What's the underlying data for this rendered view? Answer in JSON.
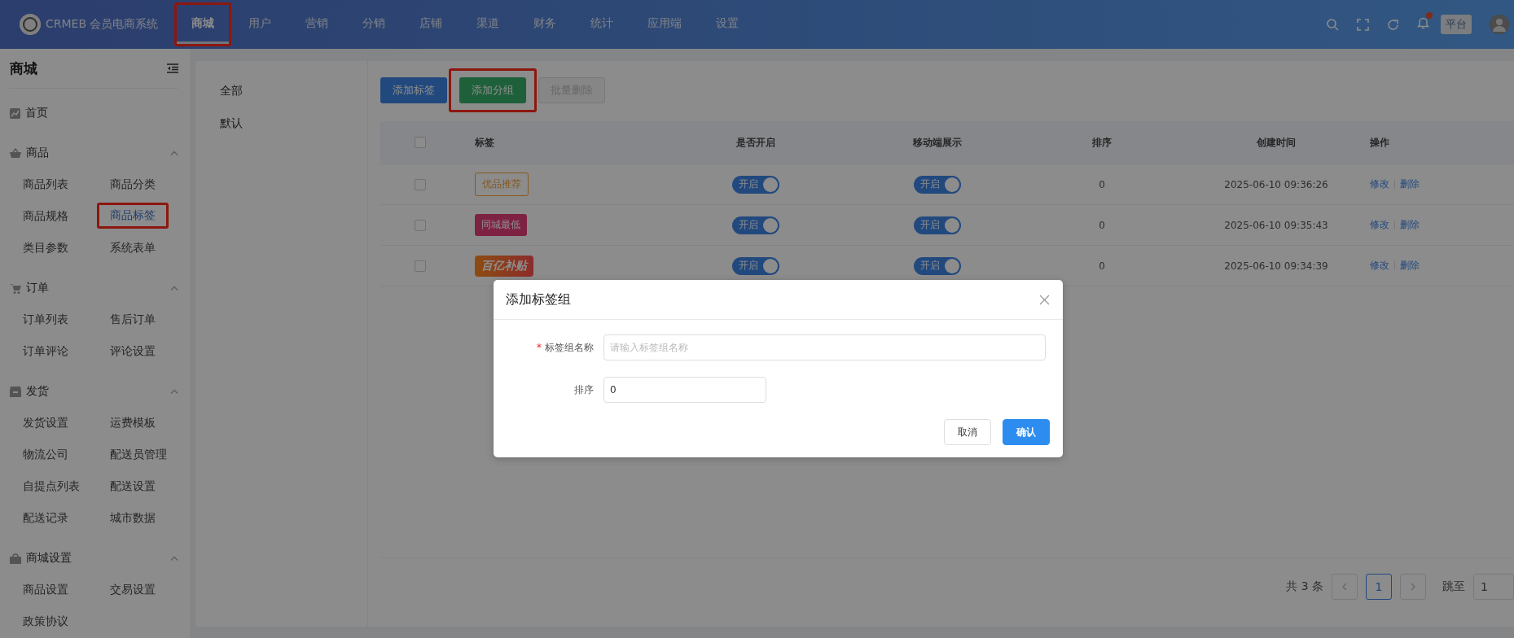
{
  "topbar": {
    "brand": "CRMEB 会员电商系统",
    "nav": [
      {
        "label": "商城",
        "selected": true,
        "highlighted": true
      },
      {
        "label": "用户",
        "selected": false,
        "highlighted": false
      },
      {
        "label": "营销",
        "selected": false,
        "highlighted": false
      },
      {
        "label": "分销",
        "selected": false,
        "highlighted": false
      },
      {
        "label": "店铺",
        "selected": false,
        "highlighted": false
      },
      {
        "label": "渠道",
        "selected": false,
        "highlighted": false
      },
      {
        "label": "财务",
        "selected": false,
        "highlighted": false
      },
      {
        "label": "统计",
        "selected": false,
        "highlighted": false
      },
      {
        "label": "应用端",
        "selected": false,
        "highlighted": false
      },
      {
        "label": "设置",
        "selected": false,
        "highlighted": false
      }
    ],
    "notification_dot": true,
    "role_badge": "平台"
  },
  "sidebar": {
    "title": "商城",
    "groups": [
      {
        "label": "首页",
        "expanded": false
      },
      {
        "label": "商品",
        "expanded": true,
        "children": [
          {
            "label": "商品列表",
            "selected": false,
            "highlighted": false
          },
          {
            "label": "商品分类",
            "selected": false,
            "highlighted": false
          },
          {
            "label": "商品规格",
            "selected": false,
            "highlighted": false
          },
          {
            "label": "商品标签",
            "selected": true,
            "highlighted": true
          },
          {
            "label": "类目参数",
            "selected": false,
            "highlighted": false
          },
          {
            "label": "系统表单",
            "selected": false,
            "highlighted": false
          }
        ]
      },
      {
        "label": "订单",
        "expanded": true,
        "children": [
          {
            "label": "订单列表",
            "selected": false,
            "highlighted": false
          },
          {
            "label": "售后订单",
            "selected": false,
            "highlighted": false
          },
          {
            "label": "订单评论",
            "selected": false,
            "highlighted": false
          },
          {
            "label": "评论设置",
            "selected": false,
            "highlighted": false
          }
        ]
      },
      {
        "label": "发货",
        "expanded": true,
        "children": [
          {
            "label": "发货设置",
            "selected": false,
            "highlighted": false
          },
          {
            "label": "运费模板",
            "selected": false,
            "highlighted": false
          },
          {
            "label": "物流公司",
            "selected": false,
            "highlighted": false
          },
          {
            "label": "配送员管理",
            "selected": false,
            "highlighted": false
          },
          {
            "label": "自提点列表",
            "selected": false,
            "highlighted": false
          },
          {
            "label": "配送设置",
            "selected": false,
            "highlighted": false
          },
          {
            "label": "配送记录",
            "selected": false,
            "highlighted": false
          },
          {
            "label": "城市数据",
            "selected": false,
            "highlighted": false
          }
        ]
      },
      {
        "label": "商城设置",
        "expanded": true,
        "children": [
          {
            "label": "商品设置",
            "selected": false,
            "highlighted": false
          },
          {
            "label": "交易设置",
            "selected": false,
            "highlighted": false
          },
          {
            "label": "政策协议",
            "selected": false,
            "highlighted": false
          }
        ]
      }
    ]
  },
  "group_panel": {
    "items": [
      "全部",
      "默认"
    ]
  },
  "toolbar": {
    "buttons": [
      {
        "label": "添加标签",
        "kind": "primary",
        "highlighted": false
      },
      {
        "label": "添加分组",
        "kind": "success",
        "highlighted": true
      },
      {
        "label": "批量删除",
        "kind": "disabled",
        "highlighted": false
      }
    ]
  },
  "table": {
    "header_checked": false,
    "columns": [
      "标签",
      "是否开启",
      "移动端展示",
      "排序",
      "创建时间",
      "操作"
    ],
    "rows": [
      {
        "checked": false,
        "tag": "优品推荐",
        "kind": "outline",
        "enabled": true,
        "enabled_label": "开启",
        "mobile": true,
        "mobile_label": "开启",
        "sort": "0",
        "created": "2025-06-10 09:36:26",
        "actions": [
          "修改",
          "删除"
        ]
      },
      {
        "checked": false,
        "tag": "同城最低",
        "kind": "filled",
        "enabled": true,
        "enabled_label": "开启",
        "mobile": true,
        "mobile_label": "开启",
        "sort": "0",
        "created": "2025-06-10 09:35:43",
        "actions": [
          "修改",
          "删除"
        ]
      },
      {
        "checked": false,
        "tag": "百亿补贴",
        "kind": "gradient",
        "enabled": true,
        "enabled_label": "开启",
        "mobile": true,
        "mobile_label": "开启",
        "sort": "0",
        "created": "2025-06-10 09:34:39",
        "actions": [
          "修改",
          "删除"
        ]
      }
    ]
  },
  "pagination": {
    "total": "共 3 条",
    "page": "1",
    "jump_label": "跳至",
    "jump_value": "1"
  },
  "dialog": {
    "title": "添加标签组",
    "fields": [
      {
        "label": "标签组名称",
        "required_mark": "*",
        "placeholder": "请输入标签组名称"
      },
      {
        "label": "排序",
        "value": "0"
      }
    ],
    "buttons": [
      {
        "label": "取消",
        "kind": "default"
      },
      {
        "label": "确认",
        "kind": "primary"
      }
    ]
  }
}
